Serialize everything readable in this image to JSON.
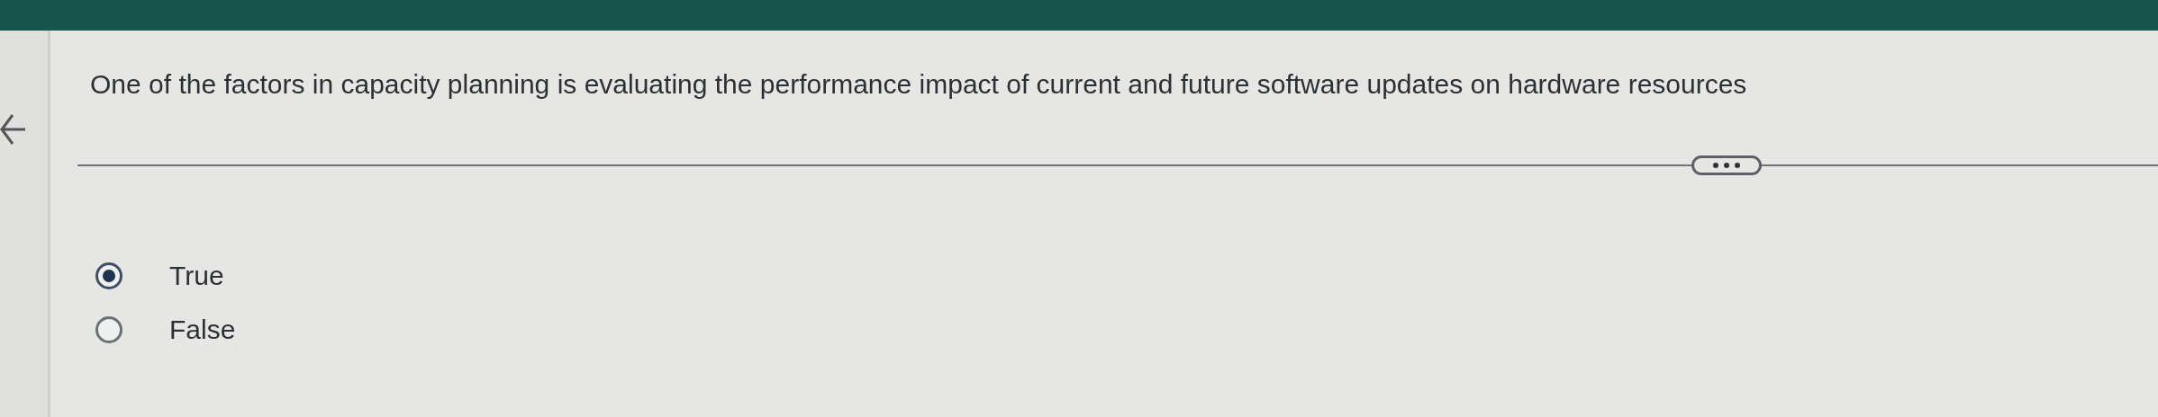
{
  "question": {
    "text": "One of the factors in capacity planning is evaluating the performance impact of current and future software updates on hardware resources"
  },
  "options": [
    {
      "label": "True",
      "selected": true
    },
    {
      "label": "False",
      "selected": false
    }
  ]
}
